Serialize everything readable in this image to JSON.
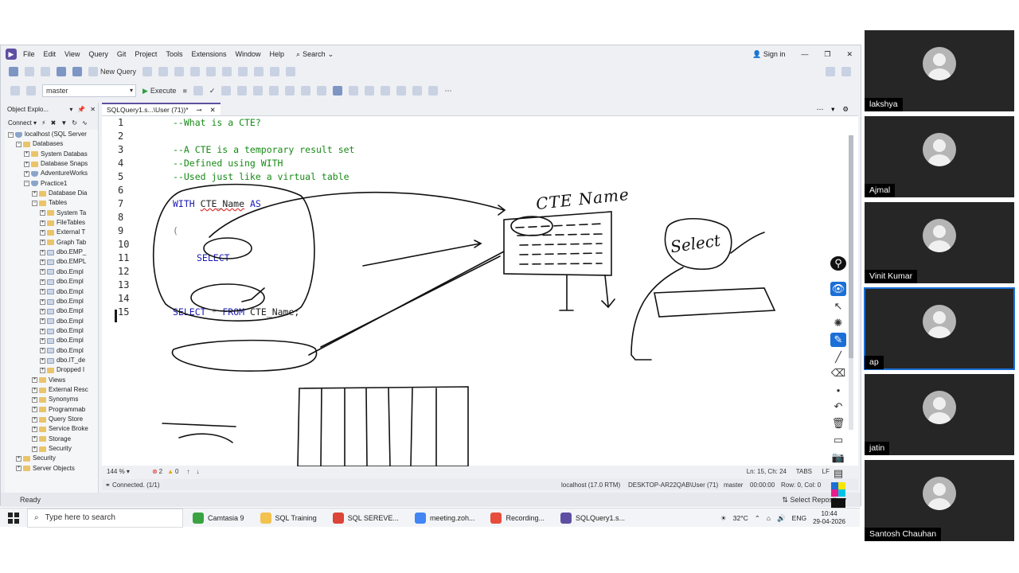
{
  "menu": {
    "items": [
      "File",
      "Edit",
      "View",
      "Query",
      "Git",
      "Project",
      "Tools",
      "Extensions",
      "Window",
      "Help"
    ],
    "search_label": "Search",
    "signin_label": "Sign in"
  },
  "toolbar": {
    "new_query_label": "New Query",
    "database_value": "master",
    "execute_label": "Execute"
  },
  "object_explorer": {
    "title": "Object Explo...",
    "connect_label": "Connect",
    "tree": [
      {
        "label": "localhost (SQL Server",
        "level": 0,
        "exp": "−",
        "kind": "db"
      },
      {
        "label": "Databases",
        "level": 1,
        "exp": "−",
        "kind": "fold"
      },
      {
        "label": "System Databas",
        "level": 2,
        "exp": "+",
        "kind": "fold"
      },
      {
        "label": "Database Snaps",
        "level": 2,
        "exp": "+",
        "kind": "fold"
      },
      {
        "label": "AdventureWorks",
        "level": 2,
        "exp": "+",
        "kind": "db"
      },
      {
        "label": "Practice1",
        "level": 2,
        "exp": "−",
        "kind": "db"
      },
      {
        "label": "Database Dia",
        "level": 3,
        "exp": "+",
        "kind": "fold"
      },
      {
        "label": "Tables",
        "level": 3,
        "exp": "−",
        "kind": "fold"
      },
      {
        "label": "System Ta",
        "level": 4,
        "exp": "+",
        "kind": "fold"
      },
      {
        "label": "FileTables",
        "level": 4,
        "exp": "+",
        "kind": "fold"
      },
      {
        "label": "External T",
        "level": 4,
        "exp": "+",
        "kind": "fold"
      },
      {
        "label": "Graph Tab",
        "level": 4,
        "exp": "+",
        "kind": "fold"
      },
      {
        "label": "dbo.EMP_",
        "level": 4,
        "exp": "+",
        "kind": "tbl"
      },
      {
        "label": "dbo.EMPL",
        "level": 4,
        "exp": "+",
        "kind": "tbl"
      },
      {
        "label": "dbo.Empl",
        "level": 4,
        "exp": "+",
        "kind": "tbl"
      },
      {
        "label": "dbo.Empl",
        "level": 4,
        "exp": "+",
        "kind": "tbl"
      },
      {
        "label": "dbo.Empl",
        "level": 4,
        "exp": "+",
        "kind": "tbl"
      },
      {
        "label": "dbo.Empl",
        "level": 4,
        "exp": "+",
        "kind": "tbl"
      },
      {
        "label": "dbo.Empl",
        "level": 4,
        "exp": "+",
        "kind": "tbl"
      },
      {
        "label": "dbo.Empl",
        "level": 4,
        "exp": "+",
        "kind": "tbl"
      },
      {
        "label": "dbo.Empl",
        "level": 4,
        "exp": "+",
        "kind": "tbl"
      },
      {
        "label": "dbo.Empl",
        "level": 4,
        "exp": "+",
        "kind": "tbl"
      },
      {
        "label": "dbo.Empl",
        "level": 4,
        "exp": "+",
        "kind": "tbl"
      },
      {
        "label": "dbo.IT_de",
        "level": 4,
        "exp": "+",
        "kind": "tbl"
      },
      {
        "label": "Dropped I",
        "level": 4,
        "exp": "+",
        "kind": "fold"
      },
      {
        "label": "Views",
        "level": 3,
        "exp": "+",
        "kind": "fold"
      },
      {
        "label": "External Resc",
        "level": 3,
        "exp": "+",
        "kind": "fold"
      },
      {
        "label": "Synonyms",
        "level": 3,
        "exp": "+",
        "kind": "fold"
      },
      {
        "label": "Programmab",
        "level": 3,
        "exp": "+",
        "kind": "fold"
      },
      {
        "label": "Query Store",
        "level": 3,
        "exp": "+",
        "kind": "fold"
      },
      {
        "label": "Service Broke",
        "level": 3,
        "exp": "+",
        "kind": "fold"
      },
      {
        "label": "Storage",
        "level": 3,
        "exp": "+",
        "kind": "fold"
      },
      {
        "label": "Security",
        "level": 3,
        "exp": "+",
        "kind": "fold"
      },
      {
        "label": "Security",
        "level": 1,
        "exp": "+",
        "kind": "fold"
      },
      {
        "label": "Server Objects",
        "level": 1,
        "exp": "+",
        "kind": "fold"
      }
    ]
  },
  "editor": {
    "tab_label": "SQLQuery1.s...\\User (71))*",
    "line_numbers": [
      "1",
      "2",
      "3",
      "4",
      "5",
      "6",
      "7",
      "8",
      "9",
      "10",
      "11",
      "12",
      "13",
      "14",
      "15"
    ],
    "lines": {
      "l1": "--What is a CTE?",
      "l3": "--A CTE is a temporary result set",
      "l4": "--Defined using WITH",
      "l5": "--Used just like a virtual table",
      "l7_kw1": "WITH",
      "l7_id": "CTE_Name",
      "l7_kw2": "AS",
      "l9": "(",
      "l11": "SELECT",
      "l15_kw1": "SELECT",
      "l15_star": "*",
      "l15_kw2": "FROM",
      "l15_id": "CTE_Name;"
    },
    "annotations": {
      "cte_name_note": "CTE Name",
      "select_note": "Select"
    }
  },
  "editor_status": {
    "zoom": "144 %",
    "errors": "2",
    "warnings": "0",
    "position": "Ln: 15, Ch: 24",
    "tabs": "TABS",
    "eol": "LF"
  },
  "status_bar": {
    "connected": "Connected. (1/1)",
    "server": "localhost (17.0 RTM)",
    "user": "DESKTOP-AR22QAB\\User (71)",
    "database": "master",
    "time": "00:00:00",
    "rows": "Row: 0, Col: 0"
  },
  "app_status": {
    "ready": "Ready",
    "repo": "Select Repository"
  },
  "taskbar": {
    "search_placeholder": "Type here to search",
    "apps": [
      {
        "label": "Camtasia 9",
        "color": "#3aa341"
      },
      {
        "label": "SQL Training",
        "color": "#f2c14e"
      },
      {
        "label": "SQL SEREVE...",
        "color": "#db4437"
      },
      {
        "label": "meeting.zoh...",
        "color": "#4285f4"
      },
      {
        "label": "Recording...",
        "color": "#e74c3c"
      },
      {
        "label": "SQLQuery1.s...",
        "color": "#5e4fa2"
      }
    ],
    "weather": "32°C",
    "lang": "ENG",
    "time": "10:44",
    "date": "29-04-2026"
  },
  "participants": [
    {
      "name": "lakshya",
      "active": false
    },
    {
      "name": "Ajmal",
      "active": false
    },
    {
      "name": "Vinit Kumar",
      "active": false
    },
    {
      "name": "ap",
      "active": true
    },
    {
      "name": "jatin",
      "active": false
    },
    {
      "name": "Santosh Chauhan",
      "active": false
    }
  ]
}
